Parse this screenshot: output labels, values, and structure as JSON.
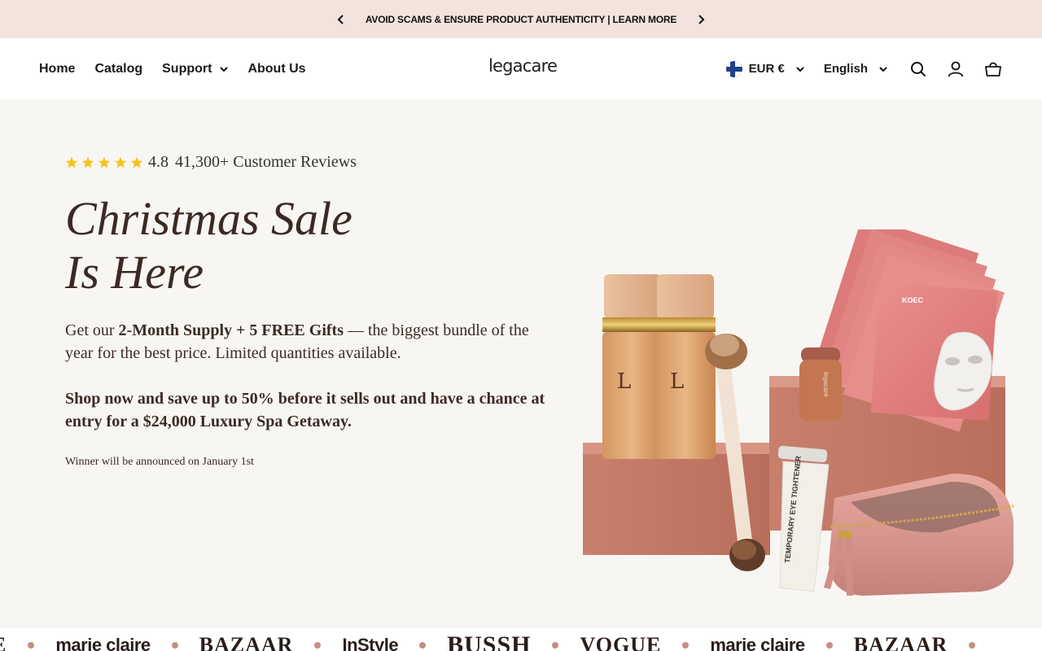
{
  "announcement": {
    "message": "AVOID SCAMS & ENSURE PRODUCT AUTHENTICITY | LEARN MORE",
    "prev_icon": "chevron-left-icon",
    "next_icon": "chevron-right-icon"
  },
  "header": {
    "nav": {
      "home": "Home",
      "catalog": "Catalog",
      "support": "Support",
      "about": "About Us"
    },
    "logo": "legacare",
    "currency": "EUR €",
    "language": "English",
    "icons": {
      "flag": "finland-flag-icon",
      "search": "search-icon",
      "account": "account-icon",
      "cart": "cart-icon"
    }
  },
  "hero": {
    "rating_score": "4.8",
    "rating_reviews": "41,300+ Customer Reviews",
    "stars": 5,
    "headline_line1": "Christmas Sale",
    "headline_line2": "Is Here",
    "para1_prefix": "Get our ",
    "para1_bold": "2-Month Supply + 5 FREE Gifts",
    "para1_suffix": " — the biggest bundle of the year for the best price. Limited quantities available.",
    "para2": "Shop now and save up to 50% before it sells out and have a chance at entry for a $24,000 Luxury Spa Getaway.",
    "winner_note": "Winner will be announced on January 1st",
    "product_box_text": "KOEC",
    "tube_text": "TEMPORARY EYE TIGHTENER",
    "jar_text": "legacare"
  },
  "press": {
    "logos": [
      "E",
      "marie claire",
      "BAZAAR",
      "InStyle",
      "BUSSH",
      "VOGUE",
      "marie claire",
      "BAZAAR"
    ]
  },
  "colors": {
    "announcement_bg": "#f2e3dd",
    "hero_bg": "#f8f6f3",
    "headline": "#3b2a24",
    "star": "#f5c518",
    "press_dot": "#c48f84"
  }
}
